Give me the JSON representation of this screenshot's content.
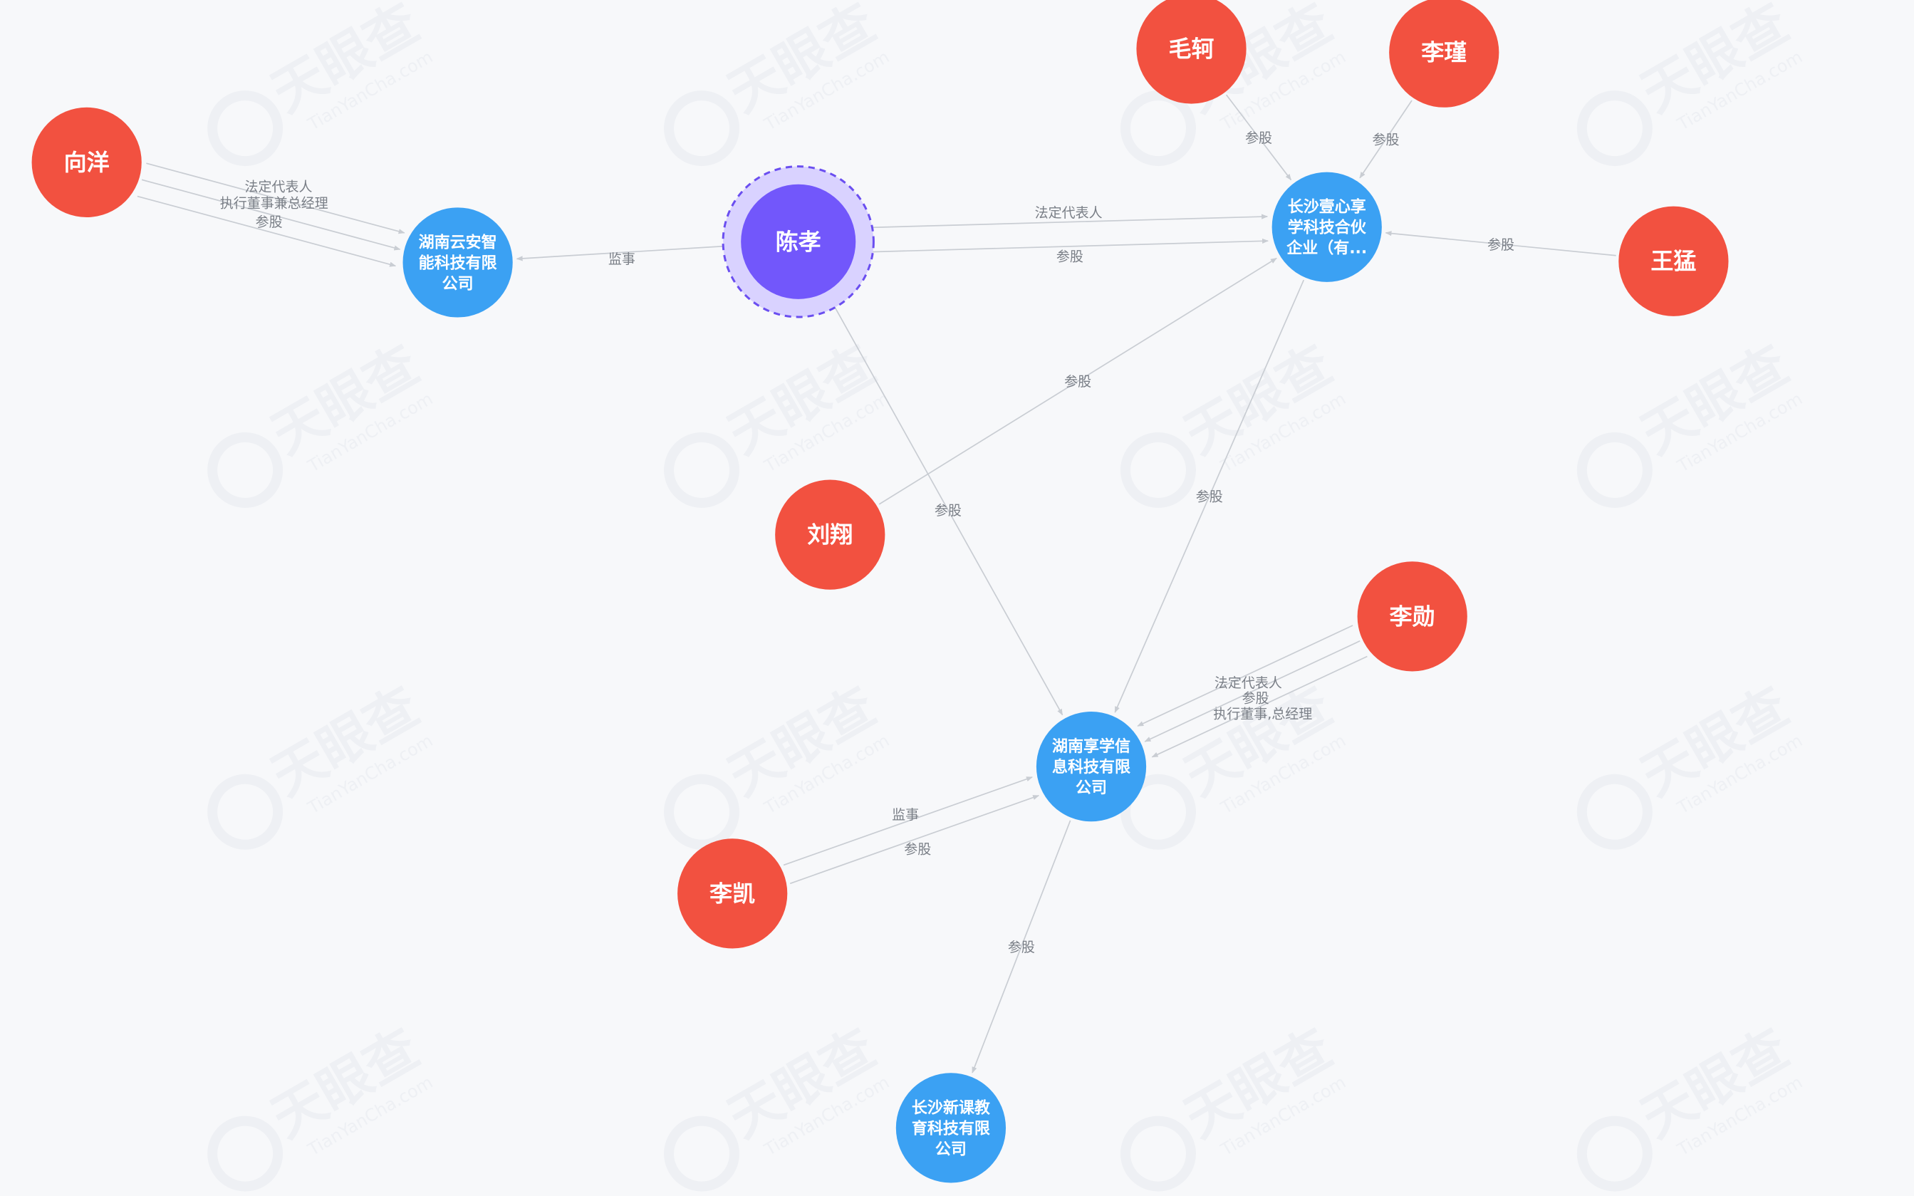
{
  "watermark": {
    "brand": "天眼查",
    "domain": "TianYanCha.com"
  },
  "colors": {
    "person": "#f25140",
    "company": "#3ba1f3",
    "focus": "#7257fb",
    "edge": "#c9cdd3",
    "label": "#7a7f87"
  },
  "nodes": {
    "xiangyang": {
      "label": "向洋",
      "type": "person"
    },
    "hn_yunan": {
      "label": "湖南云安智能科技有限公司",
      "lines": [
        "湖南云安智",
        "能科技有限",
        "公司"
      ],
      "type": "company"
    },
    "chenxiao": {
      "label": "陈孝",
      "type": "focus"
    },
    "maoke": {
      "label": "毛轲",
      "type": "person"
    },
    "lijin": {
      "label": "李瑾",
      "type": "person"
    },
    "cs_yixin": {
      "label": "长沙壹心享学科技合伙企业（有...",
      "lines": [
        "长沙壹心享",
        "学科技合伙",
        "企业（有..."
      ],
      "type": "company"
    },
    "wangmeng": {
      "label": "王猛",
      "type": "person"
    },
    "liuxiang": {
      "label": "刘翔",
      "type": "person"
    },
    "lixun": {
      "label": "李勋",
      "type": "person"
    },
    "hn_xiangxue": {
      "label": "湖南享学信息科技有限公司",
      "lines": [
        "湖南享学信",
        "息科技有限",
        "公司"
      ],
      "type": "company"
    },
    "likai": {
      "label": "李凯",
      "type": "person"
    },
    "cs_xinke": {
      "label": "长沙新课教育科技有限公司",
      "lines": [
        "长沙新课教",
        "育科技有限",
        "公司"
      ],
      "type": "company"
    }
  },
  "edges": [
    {
      "from": "xiangyang",
      "to": "hn_yunan",
      "label": "法定代表人"
    },
    {
      "from": "xiangyang",
      "to": "hn_yunan",
      "label": "执行董事兼总经理"
    },
    {
      "from": "xiangyang",
      "to": "hn_yunan",
      "label": "参股"
    },
    {
      "from": "chenxiao",
      "to": "hn_yunan",
      "label": "监事"
    },
    {
      "from": "chenxiao",
      "to": "cs_yixin",
      "label": "法定代表人"
    },
    {
      "from": "chenxiao",
      "to": "cs_yixin",
      "label": "参股"
    },
    {
      "from": "maoke",
      "to": "cs_yixin",
      "label": "参股"
    },
    {
      "from": "lijin",
      "to": "cs_yixin",
      "label": "参股"
    },
    {
      "from": "wangmeng",
      "to": "cs_yixin",
      "label": "参股"
    },
    {
      "from": "liuxiang",
      "to": "cs_yixin",
      "label": "参股"
    },
    {
      "from": "chenxiao",
      "to": "hn_xiangxue",
      "label": "参股"
    },
    {
      "from": "cs_yixin",
      "to": "hn_xiangxue",
      "label": "参股"
    },
    {
      "from": "lixun",
      "to": "hn_xiangxue",
      "label": "执行董事,总经理"
    },
    {
      "from": "lixun",
      "to": "hn_xiangxue",
      "label": "参股"
    },
    {
      "from": "lixun",
      "to": "hn_xiangxue",
      "label": "法定代表人"
    },
    {
      "from": "likai",
      "to": "hn_xiangxue",
      "label": "监事"
    },
    {
      "from": "likai",
      "to": "hn_xiangxue",
      "label": "参股"
    },
    {
      "from": "hn_xiangxue",
      "to": "cs_xinke",
      "label": "参股"
    }
  ]
}
